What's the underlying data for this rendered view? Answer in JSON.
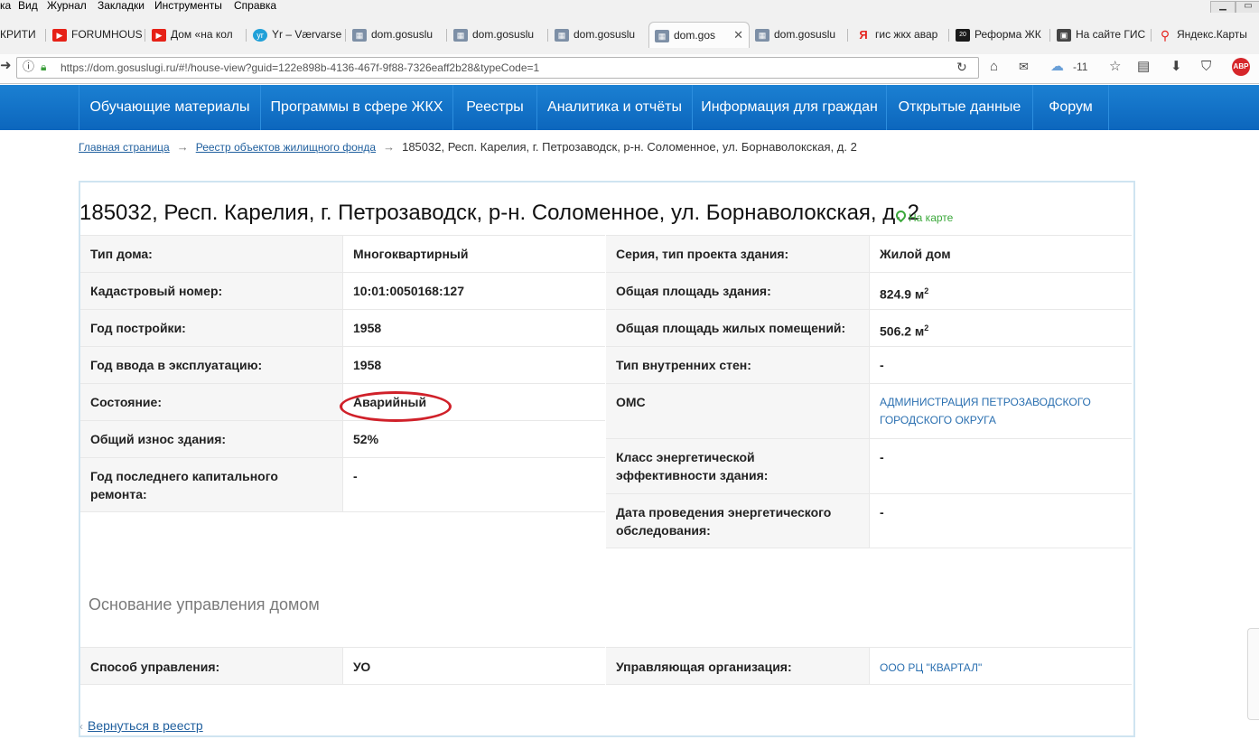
{
  "browser": {
    "menu": [
      "ка",
      "Вид",
      "Журнал",
      "Закладки",
      "Инструменты",
      "Справка"
    ],
    "tabs": [
      {
        "title": "КРИТИ",
        "icon": "generic-icon"
      },
      {
        "title": "FORUMHOUS",
        "icon": "youtube-icon"
      },
      {
        "title": "Дом «на кол",
        "icon": "youtube-icon"
      },
      {
        "title": "Yr – Værvarse",
        "icon": "yr-icon"
      },
      {
        "title": "dom.gosuslu",
        "icon": "page-icon"
      },
      {
        "title": "dom.gosuslu",
        "icon": "page-icon"
      },
      {
        "title": "dom.gosuslu",
        "icon": "page-icon"
      },
      {
        "title": "dom.gos",
        "icon": "page-icon",
        "active": true
      },
      {
        "title": "dom.gosuslu",
        "icon": "page-icon"
      },
      {
        "title": "гис жкх авар",
        "icon": "yandex-icon"
      },
      {
        "title": "Реформа ЖК",
        "icon": "reform-icon"
      },
      {
        "title": "На сайте ГИС",
        "icon": "gis-icon"
      },
      {
        "title": "Яндекс.Карты",
        "icon": "map-pin-icon"
      }
    ],
    "url": "https://dom.gosuslugi.ru/#!/house-view?guid=122e898b-4136-467f-9f88-7326eaff2b28&typeCode=1",
    "weather": "-11",
    "adblock": "ABP"
  },
  "nav": {
    "items": [
      "Обучающие материалы",
      "Программы в сфере ЖКХ",
      "Реестры",
      "Аналитика и отчёты",
      "Информация для граждан",
      "Открытые данные",
      "Форум"
    ]
  },
  "breadcrumb": {
    "home": "Главная страница",
    "registry": "Реестр объектов жилищного фонда",
    "current": "185032, Респ. Карелия, г. Петрозаводск, р-н. Соломенное, ул. Борнаволокская, д. 2",
    "arrow": "→"
  },
  "house": {
    "title": "185032, Респ. Карелия, г. Петрозаводск, р-н. Соломенное, ул. Борнаволокская, д. 2",
    "map_link": "На карте",
    "left": [
      {
        "label": "Тип дома:",
        "value": "Многоквартирный"
      },
      {
        "label": "Кадастровый номер:",
        "value": "10:01:0050168:127"
      },
      {
        "label": "Год постройки:",
        "value": "1958"
      },
      {
        "label": "Год ввода в эксплуатацию:",
        "value": "1958"
      },
      {
        "label": "Состояние:",
        "value": "Аварийный"
      },
      {
        "label": "Общий износ здания:",
        "value": "52%"
      },
      {
        "label": "Год последнего капитального ремонта:",
        "value": "-"
      }
    ],
    "right": [
      {
        "label": "Серия, тип проекта здания:",
        "value": "Жилой дом"
      },
      {
        "label": "Общая площадь здания:",
        "value": "824.9 м",
        "sup": "2"
      },
      {
        "label": "Общая площадь жилых помещений:",
        "value": "506.2 м",
        "sup": "2"
      },
      {
        "label": "Тип внутренних стен:",
        "value": "-"
      },
      {
        "label": "ОМС",
        "value": "АДМИНИСТРАЦИЯ ПЕТРОЗАВОДСКОГО ГОРОДСКОГО ОКРУГА"
      },
      {
        "label": "Класс энергетической эффективности здания:",
        "value": "-"
      },
      {
        "label": "Дата проведения энергетического обследования:",
        "value": "-"
      }
    ]
  },
  "management": {
    "title": "Основание управления домом",
    "method_label": "Способ управления:",
    "method_value": "УО",
    "org_label": "Управляющая организация:",
    "org_value": "ООО РЦ \"КВАРТАЛ\""
  },
  "back": {
    "label": "Вернуться в реестр",
    "chevron": "‹"
  },
  "colors": {
    "nav_bg": "#0c66bd",
    "highlight": "#d0212a",
    "link": "#2a6fb0"
  }
}
